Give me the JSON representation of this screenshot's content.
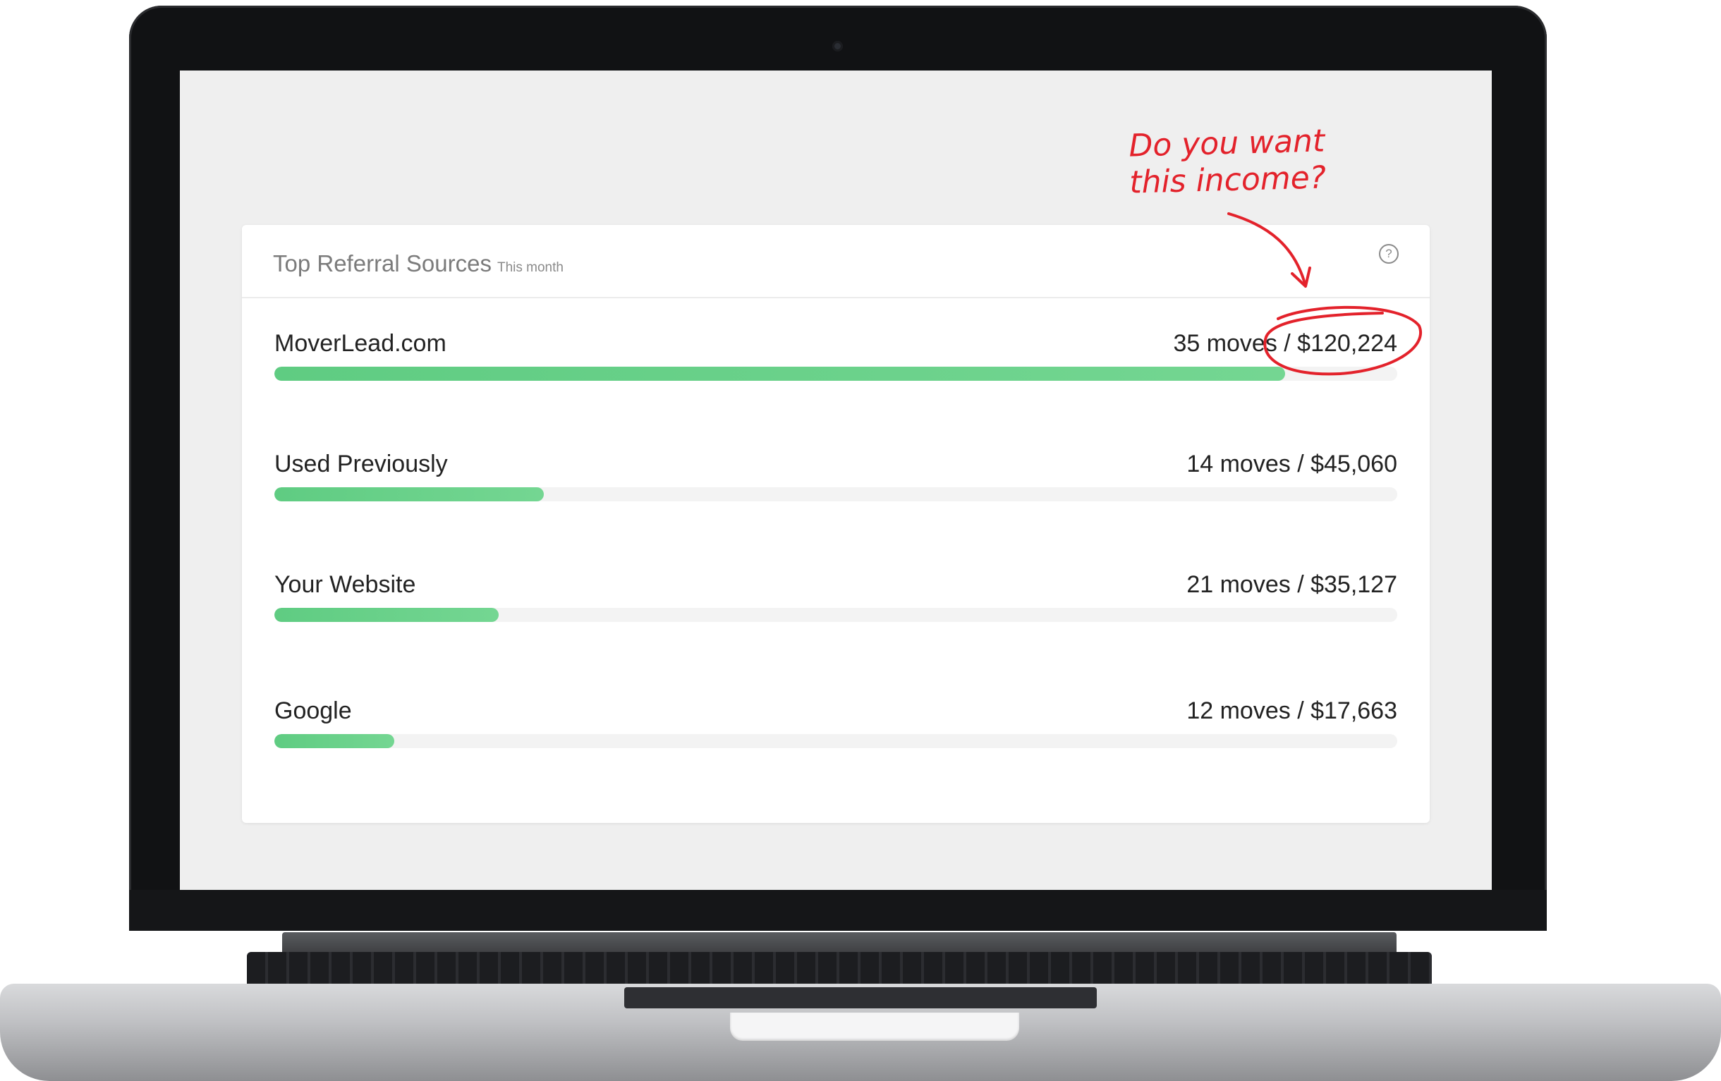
{
  "card": {
    "title": "Top Referral Sources",
    "subtitle": "This month",
    "help_icon": "question-circle-icon"
  },
  "rows": [
    {
      "label": "MoverLead.com",
      "value": "35 moves / $120,224",
      "fill": 0.9
    },
    {
      "label": "Used Previously",
      "value": "14 moves / $45,060",
      "fill": 0.24
    },
    {
      "label": "Your Website",
      "value": "21 moves / $35,127",
      "fill": 0.2
    },
    {
      "label": "Google",
      "value": "12 moves / $17,663",
      "fill": 0.107
    }
  ],
  "annotation": {
    "line1": "Do you want",
    "line2": "this income?",
    "color": "#e3222b"
  },
  "colors": {
    "bar": "#64cf86",
    "track": "#f3f3f3"
  }
}
